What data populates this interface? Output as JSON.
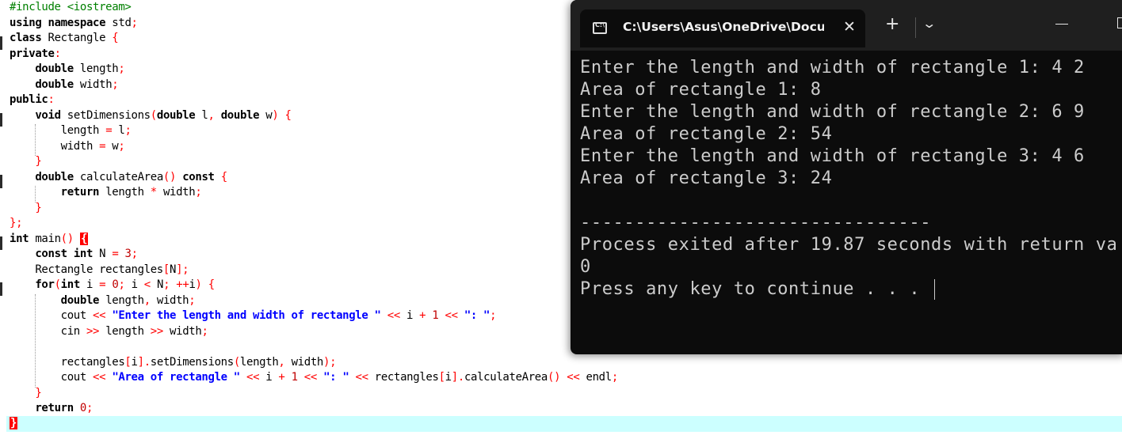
{
  "editor": {
    "lines": [
      "#include <iostream>",
      "using namespace std;",
      "class Rectangle {",
      "private:",
      "    double length;",
      "    double width;",
      "public:",
      "    void setDimensions(double l, double w) {",
      "        length = l;",
      "        width = w;",
      "    }",
      "    double calculateArea() const {",
      "        return length * width;",
      "    }",
      "};",
      "int main() {",
      "    const int N = 3;",
      "    Rectangle rectangles[N];",
      "    for(int i = 0; i < N; ++i) {",
      "        double length, width;",
      "        cout << \"Enter the length and width of rectangle \" << i + 1 << \": \";",
      "        cin >> length >> width;",
      "",
      "        rectangles[i].setDimensions(length, width);",
      "        cout << \"Area of rectangle \" << i + 1 << \": \" << rectangles[i].calculateArea() << endl;",
      "    }",
      "    return 0;",
      "}"
    ]
  },
  "terminal": {
    "tab_title": "C:\\Users\\Asus\\OneDrive\\Docu",
    "tab_icon": "console-icon",
    "close_symbol": "✕",
    "new_tab_symbol": "+",
    "dropdown_symbol": "⌄",
    "output": [
      "Enter the length and width of rectangle 1: 4 2",
      "Area of rectangle 1: 8",
      "Enter the length and width of rectangle 2: 6 9",
      "Area of rectangle 2: 54",
      "Enter the length and width of rectangle 3: 4 6",
      "Area of rectangle 3: 24",
      "",
      "--------------------------------",
      "Process exited after 19.87 seconds with return va",
      "0",
      "Press any key to continue . . . "
    ]
  },
  "colors": {
    "terminal_bg": "#0c0c0c",
    "terminal_text": "#cccccc",
    "keyword": "#000000",
    "string": "#0000ff",
    "number": "#c00000",
    "preprocessor": "#008000",
    "symbol": "#ff0000",
    "current_line": "#ccffff",
    "bracket_match": "#ff0000"
  }
}
